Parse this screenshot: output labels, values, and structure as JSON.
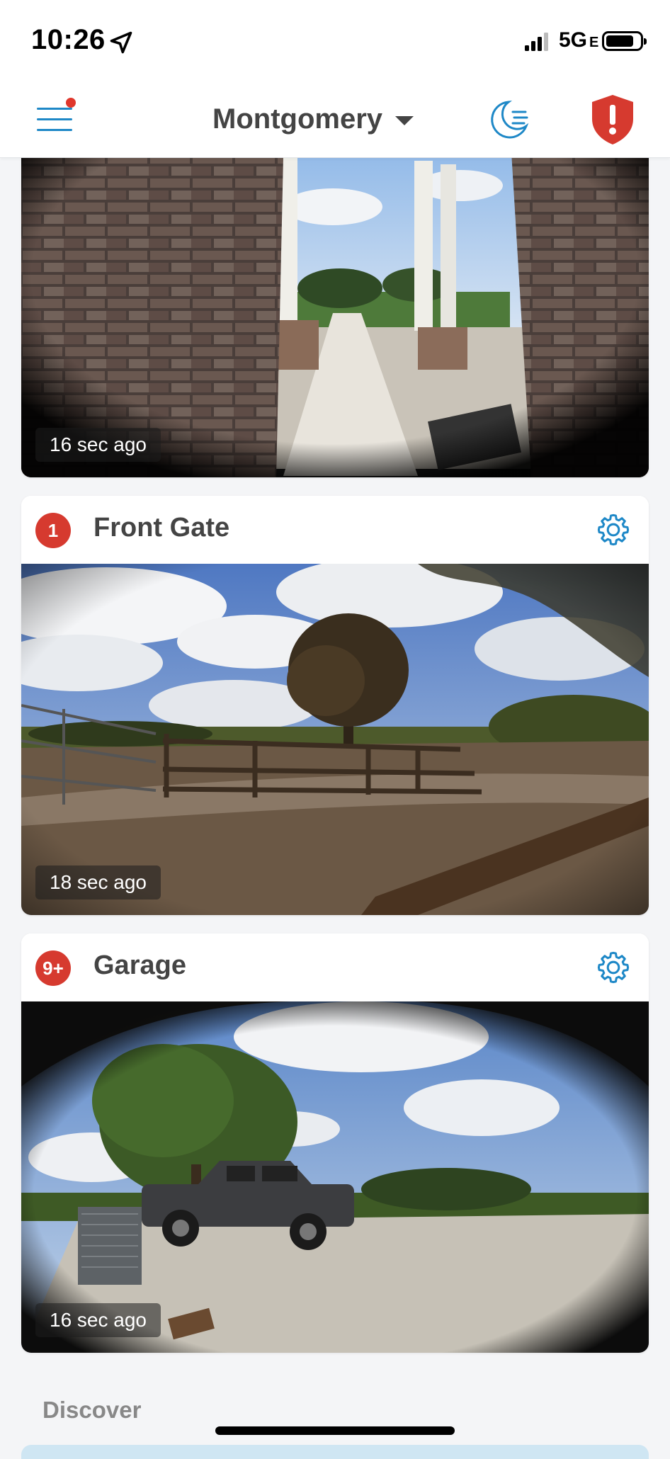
{
  "status_bar": {
    "time": "10:26",
    "network": "5G",
    "network_suffix": "E",
    "icons": [
      "location-arrow-icon",
      "cellular-signal-icon",
      "battery-icon"
    ]
  },
  "header": {
    "location": "Montgomery",
    "icons": [
      "hamburger-menu-icon",
      "moon-mode-icon",
      "alert-shield-icon"
    ],
    "menu_notification_color": "#e0372c",
    "accent_color": "#1e88c7",
    "alert_color": "#d63a2f"
  },
  "cameras": [
    {
      "name": "",
      "timestamp": "16 sec ago",
      "view": "front porch fisheye view with brick wall and white columns"
    },
    {
      "name": "Front Gate",
      "badge": "1",
      "timestamp": "18 sec ago",
      "view": "gravel driveway with wooden fence and large oak tree"
    },
    {
      "name": "Garage",
      "badge": "9+",
      "timestamp": "16 sec ago",
      "view": "fisheye view of concrete driveway with dark pickup truck and AC unit"
    }
  ],
  "discover": {
    "label": "Discover"
  }
}
